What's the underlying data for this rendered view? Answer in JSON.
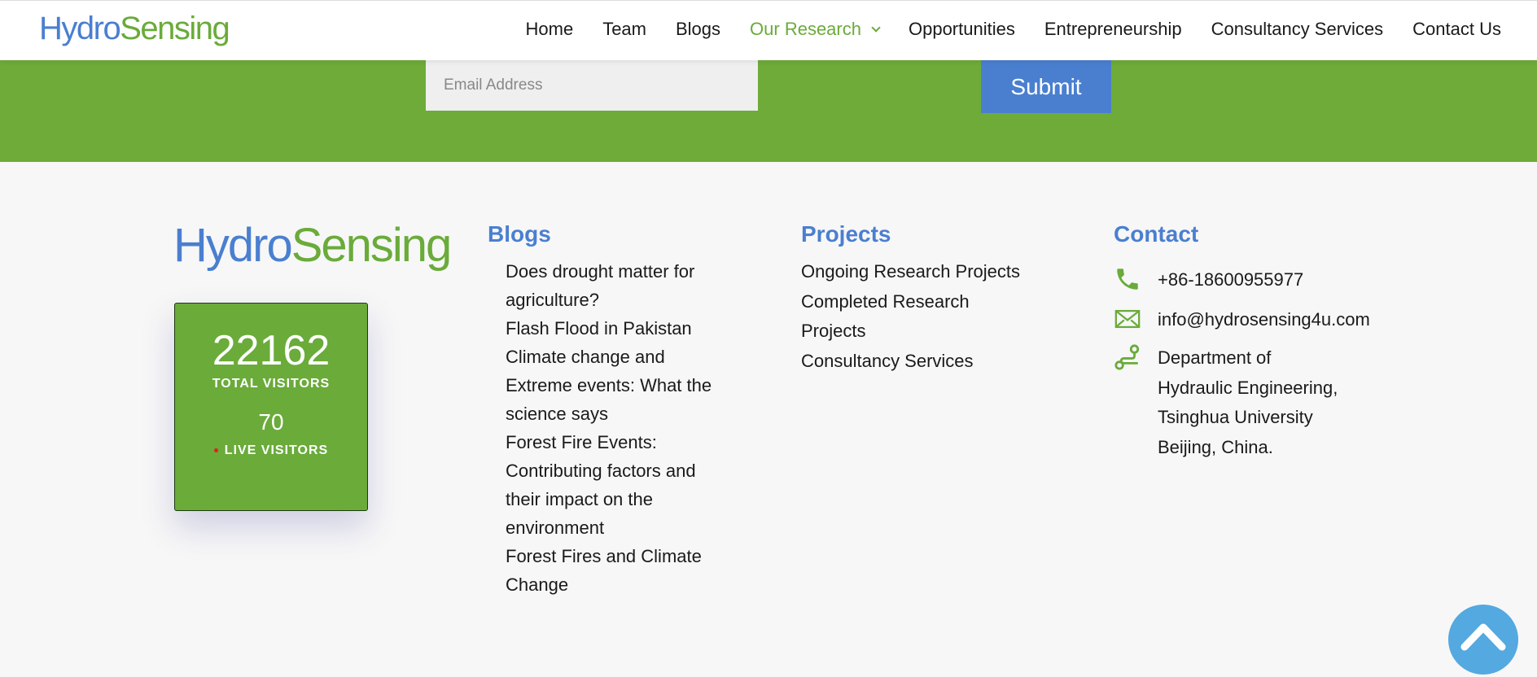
{
  "header": {
    "logo_part1": "Hydro",
    "logo_part2": "Sensing",
    "nav": [
      {
        "label": "Home"
      },
      {
        "label": "Team"
      },
      {
        "label": "Blogs"
      },
      {
        "label": "Our Research",
        "active": true
      },
      {
        "label": "Opportunities"
      },
      {
        "label": "Entrepreneurship"
      },
      {
        "label": "Consultancy Services"
      },
      {
        "label": "Contact Us"
      }
    ]
  },
  "subscribe": {
    "email_placeholder": "Email Address",
    "submit_label": "Submit"
  },
  "footer": {
    "logo_part1": "Hydro",
    "logo_part2": "Sensing",
    "counter": {
      "total": "22162",
      "total_label": "TOTAL VISITORS",
      "live": "70",
      "live_label": "LIVE VISITORS"
    },
    "blogs": {
      "title": "Blogs",
      "items": [
        "Does drought matter for agriculture?",
        "Flash Flood in Pakistan",
        "Climate change and Extreme events: What the science says",
        "Forest Fire Events: Contributing factors and their impact on the environment",
        "Forest Fires and Climate Change"
      ]
    },
    "projects": {
      "title": "Projects",
      "items": [
        "Ongoing Research Projects",
        "Completed Research Projects",
        "Consultancy Services"
      ]
    },
    "contact": {
      "title": "Contact",
      "phone": "+86-18600955977",
      "email": "info@hydrosensing4u.com",
      "address_line1": "Department of",
      "address_line2": "Hydraulic Engineering,",
      "address_line3": "Tsinghua University",
      "address_line4": "Beijing, China."
    }
  },
  "colors": {
    "green": "#6eab39",
    "blue": "#4a7fd0",
    "scroll_button": "#53a9e0"
  },
  "icons": [
    "phone-icon",
    "envelope-icon",
    "route-icon",
    "chevron-down-icon",
    "chevron-up-icon"
  ]
}
